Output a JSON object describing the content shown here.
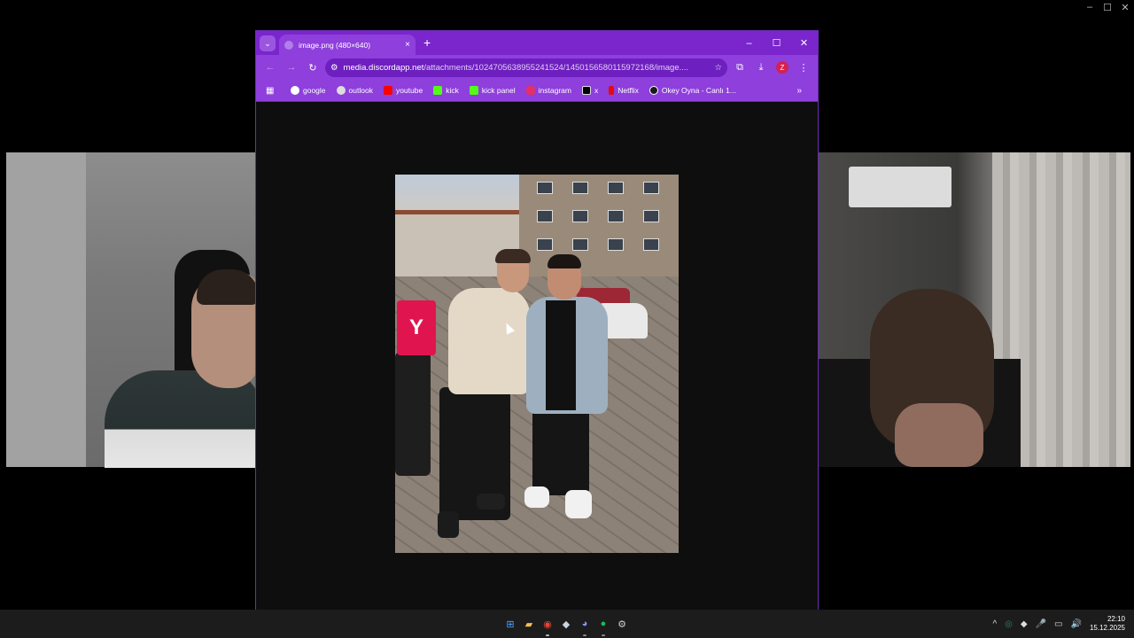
{
  "desktop": {
    "window_controls": {
      "minimize": "–",
      "maximize": "☐",
      "close": "✕"
    }
  },
  "browser": {
    "tab": {
      "title": "image.png (480×640)",
      "close": "×"
    },
    "new_tab": "+",
    "tab_dropdown": "⌄",
    "window_buttons": {
      "minimize": "–",
      "maximize": "☐",
      "close": "✕"
    },
    "toolbar": {
      "back": "←",
      "forward": "→",
      "reload": "↻",
      "site_info": "⚙",
      "url_host": "media.discordapp.net",
      "url_path": "/attachments/1024705638955241524/1450156580115972168/image....",
      "bookmark_star": "☆",
      "extensions": "⧉",
      "download": "⤓",
      "profile_initial": "Z",
      "menu": "⋮"
    },
    "bookmarks": [
      {
        "label": "google",
        "color": "#ffffff"
      },
      {
        "label": "outlook",
        "color": "#ffffff"
      },
      {
        "label": "youtube",
        "color": "#ff0000"
      },
      {
        "label": "kick",
        "color": "#53fc18"
      },
      {
        "label": "kick panel",
        "color": "#53fc18"
      },
      {
        "label": "instagram",
        "color": "#e1306c"
      },
      {
        "label": "x",
        "color": "#000000"
      },
      {
        "label": "Netflix",
        "color": "#e50914"
      },
      {
        "label": "Okey Oyna - Canlı 1...",
        "color": "#1a1a1a"
      }
    ],
    "apps_icon": "▦",
    "more_bookmarks": "»"
  },
  "photo": {
    "box_letter": "Y"
  },
  "taskbar": {
    "apps": [
      {
        "name": "start",
        "glyph": "⊞",
        "color": "#4aa3ff"
      },
      {
        "name": "file-explorer",
        "glyph": "▰",
        "color": "#f2c14e"
      },
      {
        "name": "chrome",
        "glyph": "◉",
        "color": "#ea4335"
      },
      {
        "name": "steam",
        "glyph": "◆",
        "color": "#c7d5e0"
      },
      {
        "name": "discord",
        "glyph": "◕",
        "color": "#5865f2"
      },
      {
        "name": "spotify",
        "glyph": "●",
        "color": "#1db954"
      },
      {
        "name": "settings",
        "glyph": "⚙",
        "color": "#cccccc"
      }
    ],
    "tray": {
      "chevron": "^",
      "icons": [
        "◎",
        "◆",
        "🎤",
        "▭",
        "🔊"
      ],
      "time": "22:10",
      "date": "15.12.2025"
    }
  }
}
